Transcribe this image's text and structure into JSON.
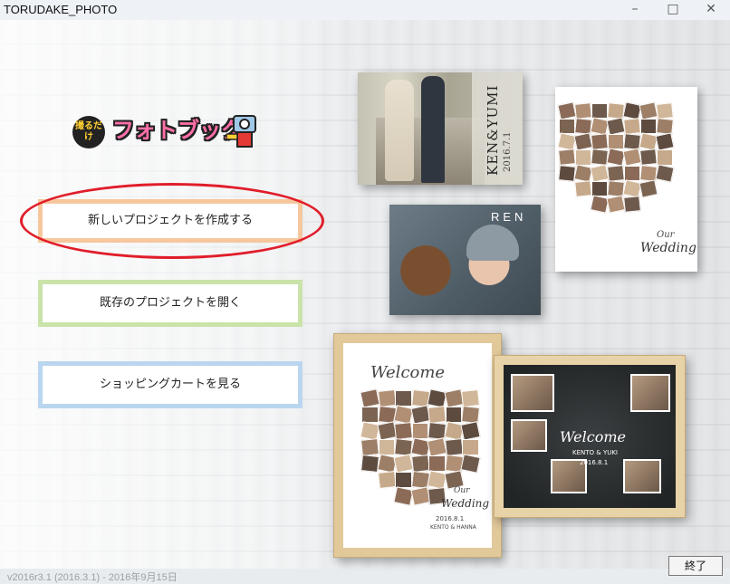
{
  "window": {
    "title": "TORUDAKE_PHOTO"
  },
  "logo": {
    "badge": "撮るだけ",
    "text": "フォトブック"
  },
  "buttons": {
    "new_project": "新しいプロジェクトを作成する",
    "open_project": "既存のプロジェクトを開く",
    "shopping_cart": "ショッピングカートを見る",
    "exit": "終了"
  },
  "version": "v2016r3.1 (2016.3.1) - 2016年9月15日",
  "samples": {
    "ken_yumi": {
      "title": "KEN&YUMI",
      "date": "2016.7.1"
    },
    "wedding_heart": {
      "our": "Our",
      "wedding": "Wedding"
    },
    "ren": {
      "title": "REN"
    },
    "welcome_frame": {
      "welcome": "Welcome",
      "our": "Our",
      "wedding": "Wedding",
      "date": "2016.8.1",
      "names": "KENTO & HANNA"
    },
    "chalkboard": {
      "welcome": "Welcome",
      "names": "KENTO & YUKI",
      "date": "2016.8.1"
    }
  },
  "colors": {
    "highlight_ellipse": "#e11d2a",
    "new_border": "#f6c79d",
    "open_border": "#c9e3a9",
    "cart_border": "#b9d6ee"
  }
}
